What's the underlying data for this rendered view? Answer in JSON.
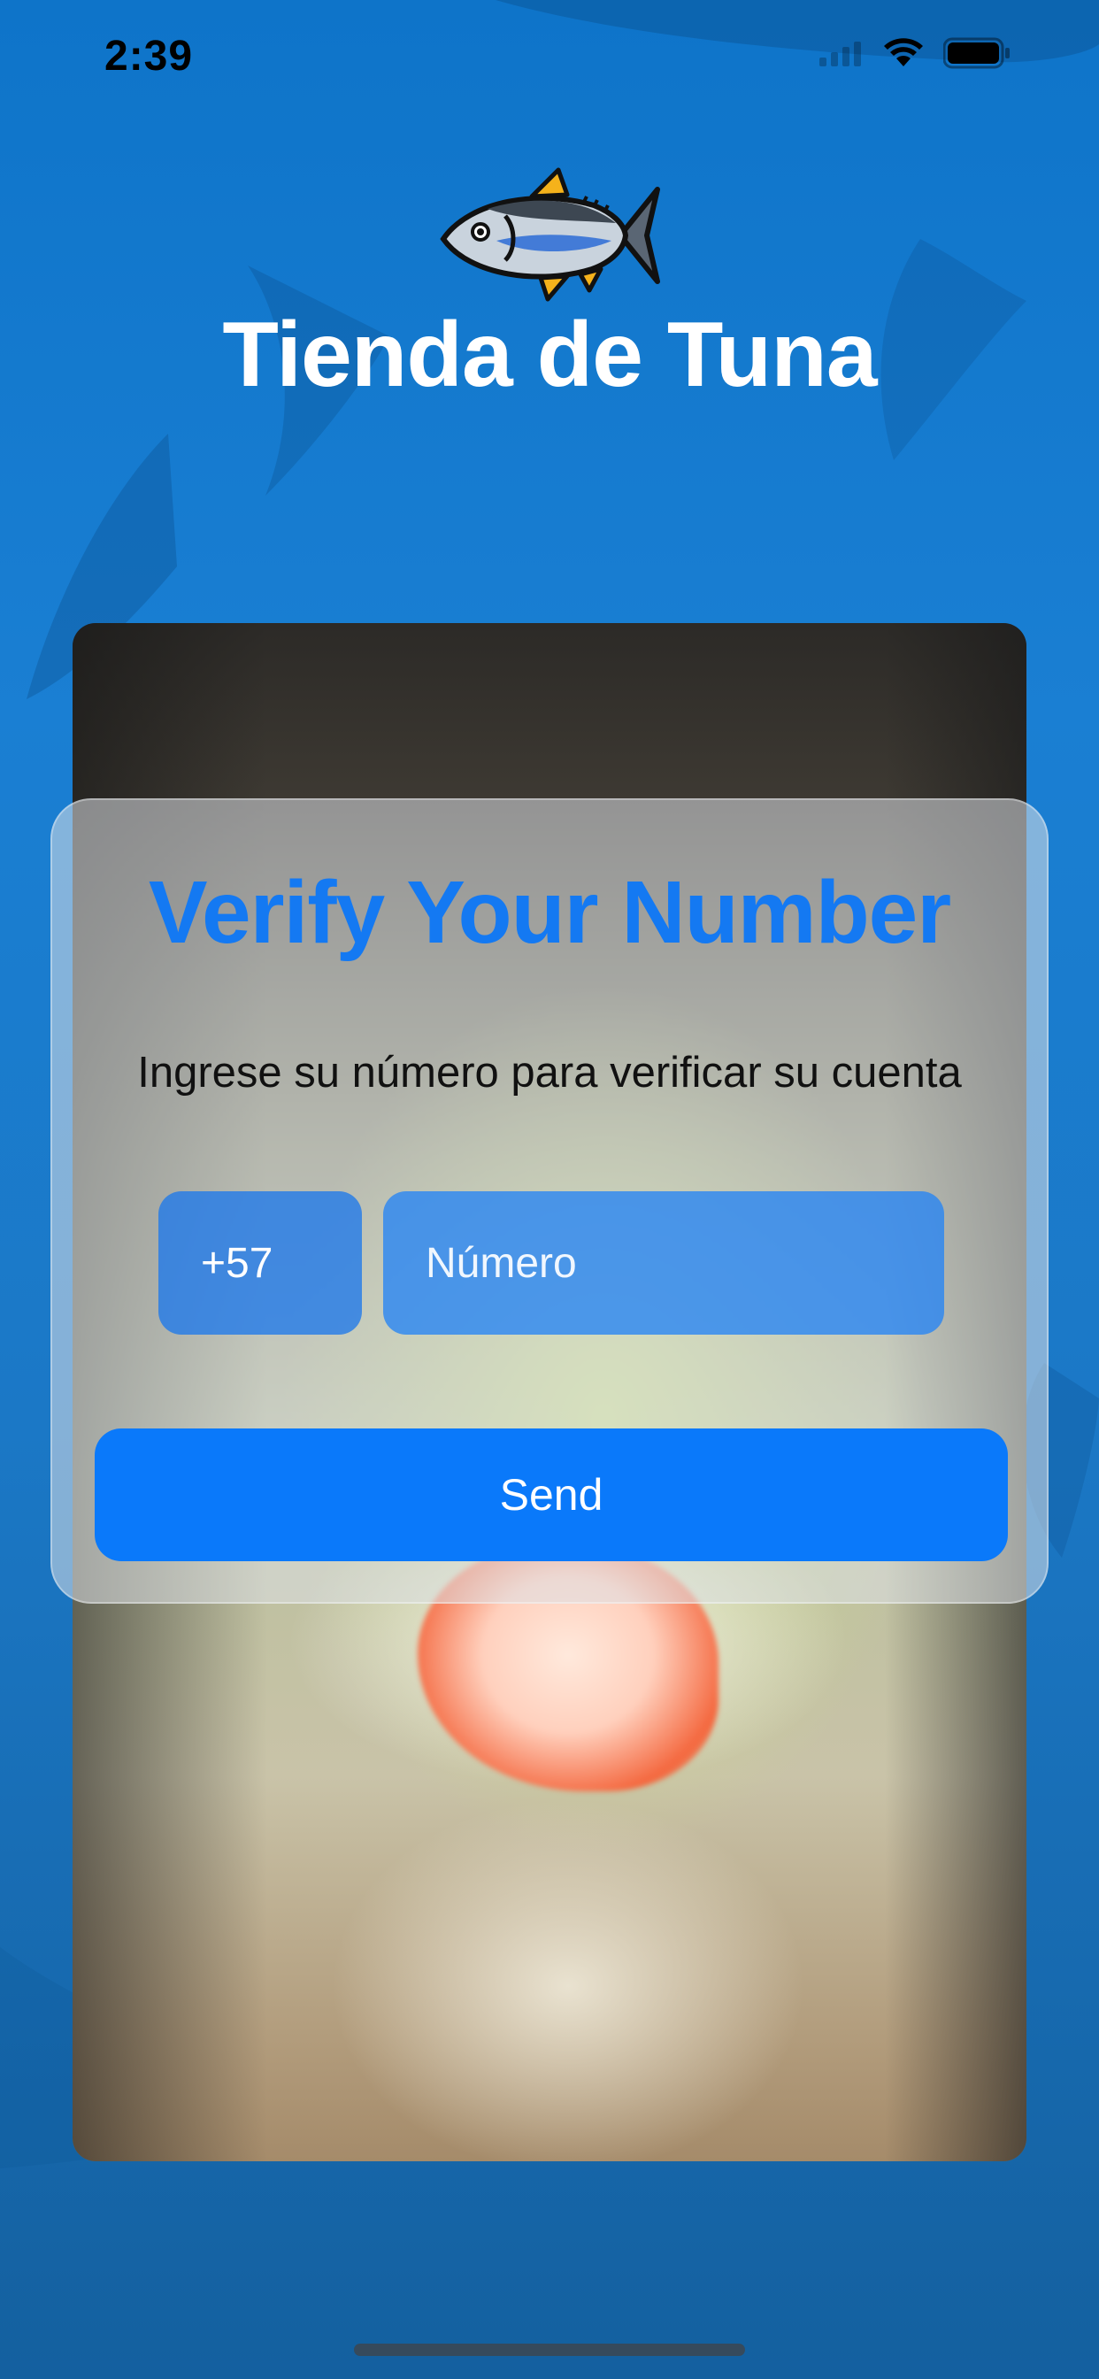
{
  "status_bar": {
    "time": "2:39",
    "icons": [
      "signal-icon",
      "wifi-icon",
      "battery-icon"
    ]
  },
  "header": {
    "logo_icon": "tuna-fish-icon",
    "app_title": "Tienda de Tuna"
  },
  "verify": {
    "title": "Verify Your Number",
    "subtitle": "Ingrese su número para verificar su cuenta",
    "country_code": "+57",
    "number_placeholder": "Número",
    "number_value": "",
    "send_label": "Send"
  },
  "colors": {
    "accent": "#0A79FA",
    "title_blue": "#1479F2",
    "background_blue": "#1A7FD3"
  }
}
